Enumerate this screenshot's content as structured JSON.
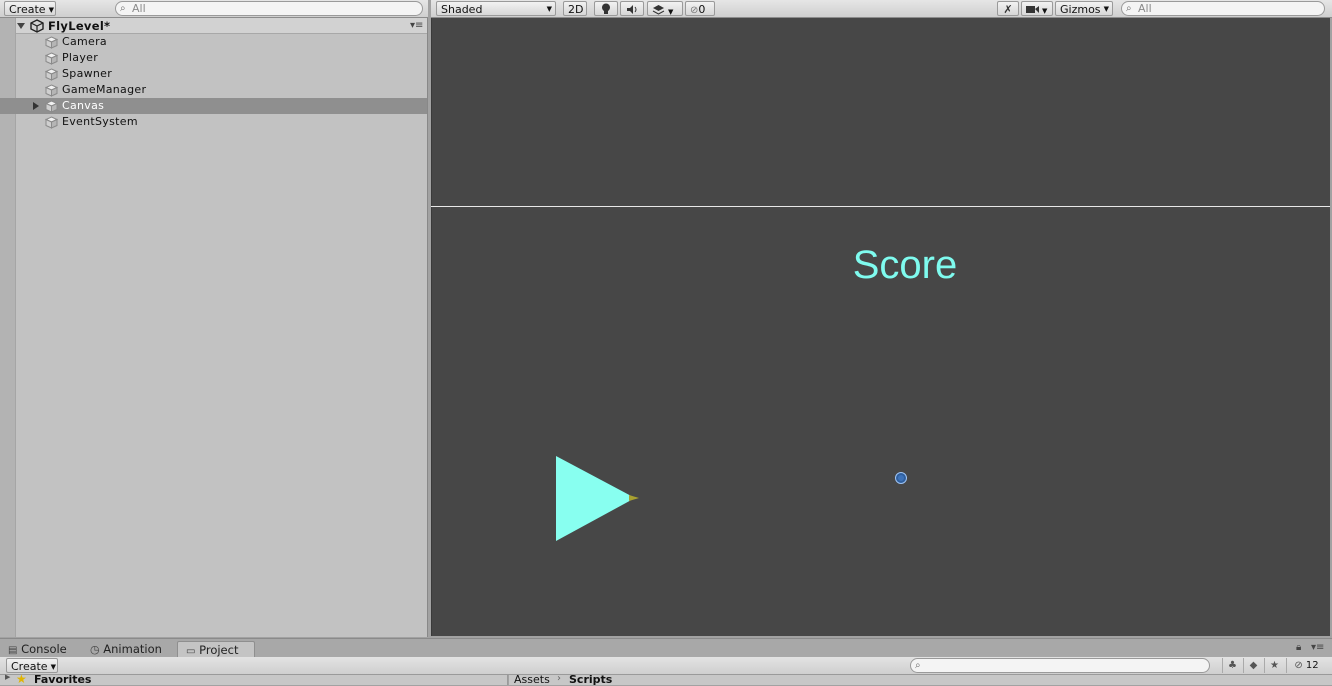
{
  "hierarchy": {
    "create_label": "Create",
    "search_placeholder": "All",
    "scene_name": "FlyLevel*",
    "items": [
      {
        "label": "Camera"
      },
      {
        "label": "Player"
      },
      {
        "label": "Spawner"
      },
      {
        "label": "GameManager"
      },
      {
        "label": "Canvas"
      },
      {
        "label": "EventSystem"
      }
    ],
    "selected_item": "Canvas"
  },
  "scene_toolbar": {
    "shading_mode": "Shaded",
    "mode_2d": "2D",
    "hidden_count": "0",
    "gizmos_label": "Gizmos",
    "search_placeholder": "All"
  },
  "scene": {
    "score_text": "Score",
    "score_color": "#7ffbef",
    "player_color": "#88fff0",
    "background_color": "#474747"
  },
  "bottom_tabs": [
    {
      "label": "Console",
      "icon": "console-icon"
    },
    {
      "label": "Animation",
      "icon": "clock-icon"
    },
    {
      "label": "Project",
      "icon": "folder-icon",
      "active": true
    }
  ],
  "project": {
    "create_label": "Create",
    "hidden_count": "12",
    "favorites_label": "Favorites",
    "breadcrumb": [
      "Assets",
      "Scripts"
    ]
  }
}
